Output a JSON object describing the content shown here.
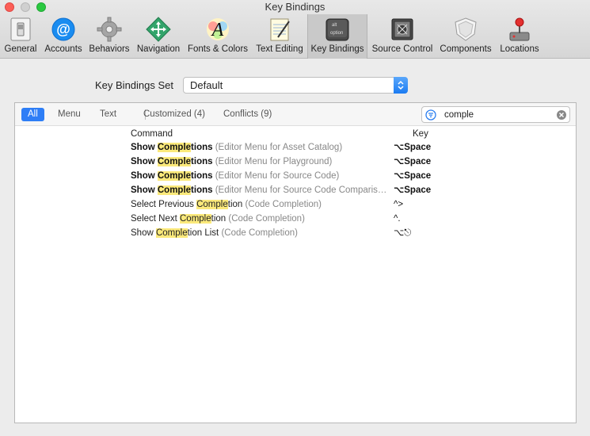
{
  "window": {
    "title": "Key Bindings"
  },
  "toolbar": {
    "items": [
      {
        "label": "General",
        "icon": "general-switch-icon"
      },
      {
        "label": "Accounts",
        "icon": "at-sign-icon"
      },
      {
        "label": "Behaviors",
        "icon": "gear-icon"
      },
      {
        "label": "Navigation",
        "icon": "navigation-arrows-icon"
      },
      {
        "label": "Fonts & Colors",
        "icon": "font-letter-icon"
      },
      {
        "label": "Text Editing",
        "icon": "notepad-icon"
      },
      {
        "label": "Key Bindings",
        "icon": "option-key-icon"
      },
      {
        "label": "Source Control",
        "icon": "safe-vault-icon"
      },
      {
        "label": "Components",
        "icon": "shield-icon"
      },
      {
        "label": "Locations",
        "icon": "joystick-icon"
      }
    ],
    "selected": "Key Bindings"
  },
  "keybindings_set": {
    "label": "Key Bindings Set",
    "value": "Default"
  },
  "filters": {
    "all": "All",
    "menu": "Menu",
    "text": "Text",
    "customized": "Customized (4)",
    "conflicts": "Conflicts (9)"
  },
  "search": {
    "value": "comple"
  },
  "table": {
    "headers": {
      "command": "Command",
      "key": "Key"
    },
    "rows": [
      {
        "pre": "Show ",
        "match": "Comple",
        "post": "tions",
        "bold": true,
        "context": " (Editor Menu for Asset Catalog)",
        "key": "⌥Space"
      },
      {
        "pre": "Show ",
        "match": "Comple",
        "post": "tions",
        "bold": true,
        "context": " (Editor Menu for Playground)",
        "key": "⌥Space"
      },
      {
        "pre": "Show ",
        "match": "Comple",
        "post": "tions",
        "bold": true,
        "context": " (Editor Menu for Source Code)",
        "key": "⌥Space"
      },
      {
        "pre": "Show ",
        "match": "Comple",
        "post": "tions",
        "bold": true,
        "context": " (Editor Menu for Source Code Comparis…",
        "key": "⌥Space"
      },
      {
        "pre": "Select Previous ",
        "match": "Comple",
        "post": "tion",
        "bold": false,
        "context": " (Code Completion)",
        "key": "^>"
      },
      {
        "pre": "Select Next ",
        "match": "Comple",
        "post": "tion",
        "bold": false,
        "context": " (Code Completion)",
        "key": "^."
      },
      {
        "pre": "Show ",
        "match": "Comple",
        "post": "tion List",
        "bold": false,
        "context": " (Code Completion)",
        "key": "⌥⎋"
      }
    ]
  }
}
